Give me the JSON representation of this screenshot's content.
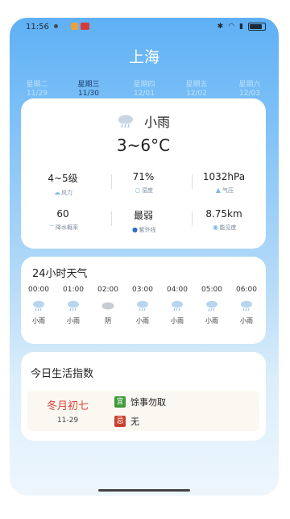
{
  "status": {
    "time": "11:56",
    "signal_icon": "signal-icon",
    "wifi_icon": "wifi-icon",
    "battery_icon": "battery-icon"
  },
  "city": "上海",
  "days": [
    {
      "name": "星期二",
      "date": "11/29",
      "active": false
    },
    {
      "name": "星期三",
      "date": "11/30",
      "active": true
    },
    {
      "name": "星期四",
      "date": "12/01",
      "active": false
    },
    {
      "name": "星期五",
      "date": "12/02",
      "active": false
    },
    {
      "name": "星期六",
      "date": "12/03",
      "active": false
    }
  ],
  "current": {
    "condition": "小雨",
    "icon": "rain-cloud-icon",
    "temp_range": "3~6°C",
    "stats_row1": [
      {
        "value": "4~5级",
        "label": "风力",
        "icon": "wind-icon"
      },
      {
        "value": "71%",
        "label": "湿度",
        "icon": "humidity-icon"
      },
      {
        "value": "1032hPa",
        "label": "气压",
        "icon": "pressure-icon"
      }
    ],
    "stats_row2": [
      {
        "value": "60",
        "label": "降水概率",
        "icon": "precip-icon"
      },
      {
        "value": "最弱",
        "label": "紫外线",
        "icon": "uv-icon"
      },
      {
        "value": "8.75km",
        "label": "能见度",
        "icon": "visibility-icon"
      }
    ]
  },
  "hourly": {
    "title": "24小时天气",
    "items": [
      {
        "time": "00:00",
        "cond": "小雨",
        "icon": "rain-cloud-icon"
      },
      {
        "time": "01:00",
        "cond": "小雨",
        "icon": "rain-cloud-icon"
      },
      {
        "time": "02:00",
        "cond": "阴",
        "icon": "overcast-cloud-icon"
      },
      {
        "time": "03:00",
        "cond": "小雨",
        "icon": "rain-cloud-icon"
      },
      {
        "time": "04:00",
        "cond": "小雨",
        "icon": "rain-cloud-icon"
      },
      {
        "time": "05:00",
        "cond": "小雨",
        "icon": "rain-cloud-icon"
      },
      {
        "time": "06:00",
        "cond": "小雨",
        "icon": "rain-cloud-icon"
      }
    ]
  },
  "life": {
    "title": "今日生活指数",
    "lunar": "冬月初七",
    "date": "11-29",
    "yi_badge": "宜",
    "yi": "馀事勿取",
    "ji_badge": "忌",
    "ji": "无"
  }
}
